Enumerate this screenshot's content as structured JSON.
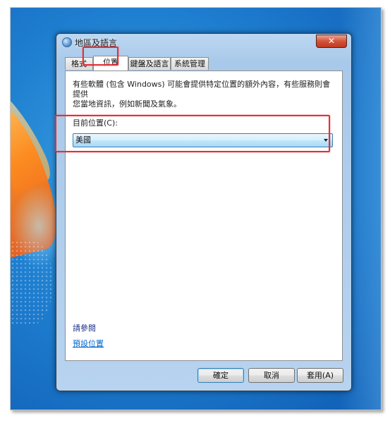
{
  "window": {
    "title": "地區及語言"
  },
  "tabs": [
    {
      "label": "格式"
    },
    {
      "label": "位置"
    },
    {
      "label": "鍵盤及語言"
    },
    {
      "label": "系統管理"
    }
  ],
  "location_tab": {
    "description_line1": "有些軟體 (包含 Windows) 可能會提供特定位置的額外內容，有些服務則會提供",
    "description_line2": "您當地資訊，例如新聞及氣象。",
    "current_location_label": "目前位置(C):",
    "current_location_value": "美國",
    "see_also": "請參閱",
    "default_location_link": "預設位置"
  },
  "buttons": {
    "ok": "確定",
    "cancel": "取消",
    "apply": "套用(A)",
    "close": "✕"
  },
  "colors": {
    "highlight": "#e0313a",
    "combo_border": "#3c7fb1"
  }
}
